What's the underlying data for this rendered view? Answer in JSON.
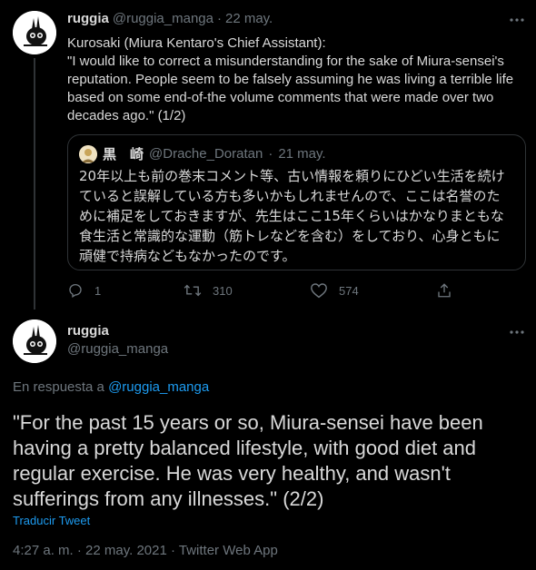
{
  "tweet1": {
    "name": "ruggia",
    "handle": "@ruggia_manga",
    "dot": "·",
    "date": "22 may.",
    "text": "Kurosaki (Miura Kentaro's Chief Assistant):\n\"I would like to correct a misunderstanding for the sake of Miura-sensei's reputation. People seem to be falsely assuming he was living a terrible life based on some end-of-the volume comments that were made over two decades ago.\" (1/2)",
    "quote": {
      "name": "黒　崎",
      "handle": "@Drache_Doratan",
      "dot": "·",
      "date": "21 may.",
      "text": "20年以上も前の巻末コメント等、古い情報を頼りにひどい生活を続けていると誤解している方も多いかもしれませんので、ここは名誉のために補足をしておきますが、先生はここ15年くらいはかなりまともな食生活と常識的な運動（筋トレなどを含む）をしており、心身ともに頑健で持病などもなかったのです。"
    },
    "actions": {
      "replies": "1",
      "retweets": "310",
      "likes": "574"
    }
  },
  "tweet2": {
    "name": "ruggia",
    "handle": "@ruggia_manga",
    "reply_prefix": "En respuesta a",
    "reply_to": "@ruggia_manga",
    "text": "\"For the past 15 years or so, Miura-sensei have been having a pretty balanced lifestyle, with good diet and regular exercise. He was very healthy, and wasn't sufferings from any illnesses.\" (2/2)",
    "translate": "Traducir Tweet",
    "timestamp": "4:27 a. m. · 22 may. 2021 · Twitter Web App"
  },
  "colors": {
    "background": "#000000",
    "text": "#d9d9d9",
    "muted": "#6e767d",
    "accent": "#1d9bf0",
    "border": "#2f3336"
  },
  "icons": [
    "avatar-rabbit-icon",
    "more-icon",
    "reply-icon",
    "retweet-icon",
    "like-icon",
    "share-icon"
  ]
}
